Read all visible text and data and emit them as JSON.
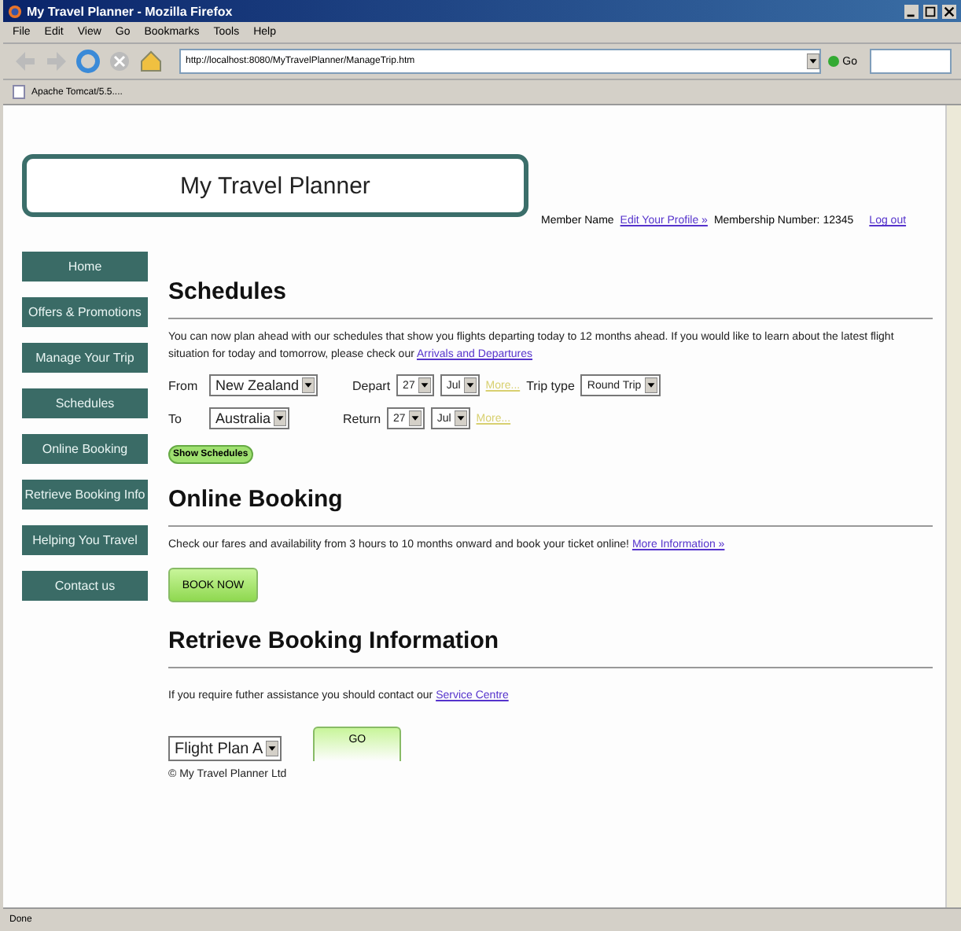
{
  "window": {
    "title": "My Travel Planner - Mozilla Firefox"
  },
  "menu": [
    "File",
    "Edit",
    "View",
    "Go",
    "Bookmarks",
    "Tools",
    "Help"
  ],
  "toolbar": {
    "address": "http://localhost:8080/MyTravelPlanner/ManageTrip.htm",
    "go_label": "Go"
  },
  "bookmarks": [
    "Apache Tomcat/5.5...."
  ],
  "header": {
    "logo": "My Travel Planner",
    "member_label": "Member Name",
    "edit_profile": "Edit Your Profile »",
    "membership": "Membership Number: 12345",
    "logout": "Log out"
  },
  "sidebar": {
    "items": [
      "Home",
      "Offers & Promotions",
      "Manage Your Trip",
      "Schedules",
      "Online Booking",
      "Retrieve Booking Info",
      "Helping You Travel",
      "Contact us"
    ]
  },
  "schedules": {
    "heading": "Schedules",
    "intro": "You can now plan ahead with our schedules that show you flights departing today to 12 months ahead. If you would like to learn about the latest flight situation for today and tomorrow, please check our",
    "intro_link": "Arrivals and Departures",
    "from_label": "From",
    "from": "New Zealand",
    "depart_label": "Depart",
    "depart_day": "27",
    "depart_month": "Jul",
    "depart_more": "More...",
    "trip_type_label": "Trip type",
    "trip_type": "Round Trip",
    "to_label": "To",
    "to": "Australia",
    "return_label": "Return",
    "return_day": "27",
    "return_month": "Jul",
    "return_more": "More...",
    "button": "Show Schedules"
  },
  "online_booking": {
    "heading": "Online Booking",
    "text": "Check our fares and availability from 3 hours to 10 months onward and book your ticket online!",
    "link": "More Information »",
    "button": "BOOK NOW"
  },
  "retrieve": {
    "heading": "Retrieve Booking Information",
    "text": "If you require futher assistance you should contact our",
    "link": "Service Centre",
    "plan": "Flight Plan A",
    "button": "GO"
  },
  "footer": "© My Travel Planner Ltd",
  "status_bar": "Done"
}
